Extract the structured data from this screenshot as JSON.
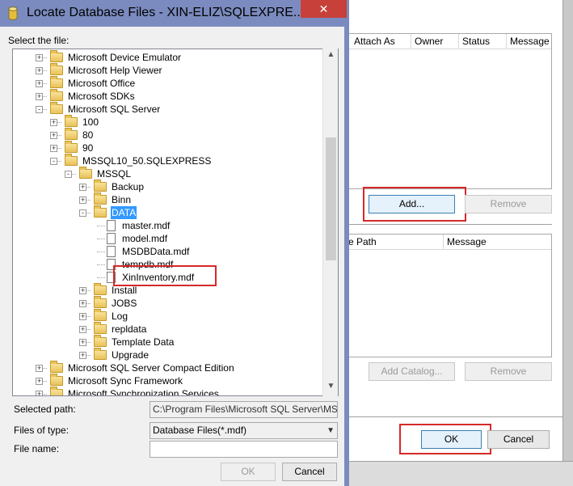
{
  "background_window": {
    "top_grid_columns": [
      "Attach As",
      "Owner",
      "Status",
      "Message"
    ],
    "add_label": "Add...",
    "remove_label": "Remove",
    "bottom_grid_columns": [
      "e Path",
      "Message"
    ],
    "add_catalog_label": "Add Catalog...",
    "remove_catalog_label": "Remove",
    "ok_label": "OK",
    "cancel_label": "Cancel"
  },
  "dialog": {
    "title": "Locate Database Files - XIN-ELIZ\\SQLEXPRE...",
    "close_icon": "✕",
    "select_label": "Select the file:",
    "tree": [
      {
        "label": "Microsoft Device Emulator",
        "level": 2,
        "kind": "folder",
        "expander": "+"
      },
      {
        "label": "Microsoft Help Viewer",
        "level": 2,
        "kind": "folder",
        "expander": "+"
      },
      {
        "label": "Microsoft Office",
        "level": 2,
        "kind": "folder",
        "expander": "+"
      },
      {
        "label": "Microsoft SDKs",
        "level": 2,
        "kind": "folder",
        "expander": "+"
      },
      {
        "label": "Microsoft SQL Server",
        "level": 2,
        "kind": "folder",
        "expander": "-"
      },
      {
        "label": "100",
        "level": 3,
        "kind": "folder",
        "expander": "+"
      },
      {
        "label": "80",
        "level": 3,
        "kind": "folder",
        "expander": "+"
      },
      {
        "label": "90",
        "level": 3,
        "kind": "folder",
        "expander": "+"
      },
      {
        "label": "MSSQL10_50.SQLEXPRESS",
        "level": 3,
        "kind": "folder",
        "expander": "-"
      },
      {
        "label": "MSSQL",
        "level": 4,
        "kind": "folder",
        "expander": "-"
      },
      {
        "label": "Backup",
        "level": 5,
        "kind": "folder",
        "expander": "+"
      },
      {
        "label": "Binn",
        "level": 5,
        "kind": "folder",
        "expander": "+"
      },
      {
        "label": "DATA",
        "level": 5,
        "kind": "folder",
        "expander": "-",
        "selected": true
      },
      {
        "label": "master.mdf",
        "level": 6,
        "kind": "file"
      },
      {
        "label": "model.mdf",
        "level": 6,
        "kind": "file"
      },
      {
        "label": "MSDBData.mdf",
        "level": 6,
        "kind": "file"
      },
      {
        "label": "tempdb.mdf",
        "level": 6,
        "kind": "file"
      },
      {
        "label": "XinInventory.mdf",
        "level": 6,
        "kind": "file",
        "highlight": true
      },
      {
        "label": "Install",
        "level": 5,
        "kind": "folder",
        "expander": "+"
      },
      {
        "label": "JOBS",
        "level": 5,
        "kind": "folder",
        "expander": "+"
      },
      {
        "label": "Log",
        "level": 5,
        "kind": "folder",
        "expander": "+"
      },
      {
        "label": "repldata",
        "level": 5,
        "kind": "folder",
        "expander": "+"
      },
      {
        "label": "Template Data",
        "level": 5,
        "kind": "folder",
        "expander": "+"
      },
      {
        "label": "Upgrade",
        "level": 5,
        "kind": "folder",
        "expander": "+"
      },
      {
        "label": "Microsoft SQL Server Compact Edition",
        "level": 2,
        "kind": "folder",
        "expander": "+"
      },
      {
        "label": "Microsoft Sync Framework",
        "level": 2,
        "kind": "folder",
        "expander": "+"
      },
      {
        "label": "Microsoft Synchronization Services",
        "level": 2,
        "kind": "folder",
        "expander": "+"
      }
    ],
    "selected_path_label": "Selected path:",
    "selected_path_value": "C:\\Program Files\\Microsoft SQL Server\\MSSQL",
    "files_of_type_label": "Files of type:",
    "files_of_type_value": "Database Files(*.mdf)",
    "file_name_label": "File name:",
    "file_name_value": "",
    "ok_label": "OK",
    "cancel_label": "Cancel"
  },
  "colors": {
    "titlebar": "#7b8bbf",
    "close_button": "#c7403a",
    "highlight_border": "#d62929",
    "selection": "#3399ff"
  },
  "icons": {
    "title": "database-icon",
    "folder": "folder-icon",
    "file": "file-icon",
    "scroll_up": "▲",
    "scroll_down": "▼",
    "dropdown": "▼"
  }
}
